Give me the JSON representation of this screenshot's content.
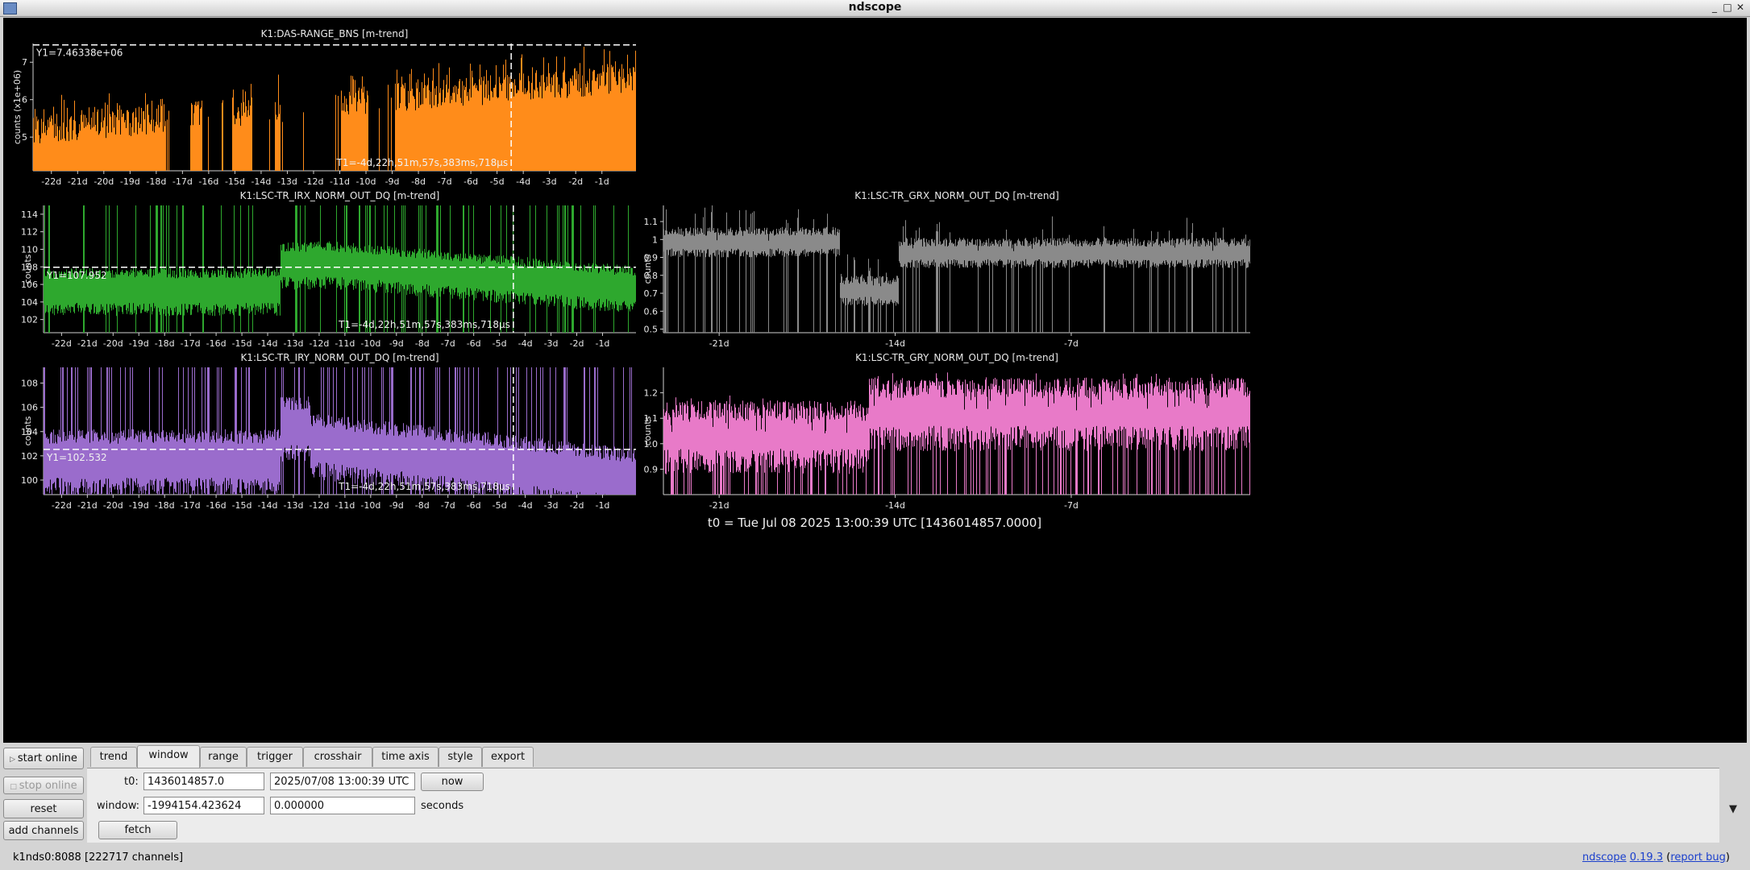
{
  "window": {
    "title": "ndscope"
  },
  "plots": [
    {
      "id": "bns",
      "title": "K1:DAS-RANGE_BNS [m-trend]",
      "ylabel": "counts (x1e+06)",
      "ylim": [
        4.1,
        7.5
      ],
      "yticks": [
        "5",
        "6",
        "7"
      ],
      "ytickvals": [
        5,
        6,
        7
      ],
      "xticks": [
        "-22d",
        "-21d",
        "-20d",
        "-19d",
        "-18d",
        "-17d",
        "-16d",
        "-15d",
        "-14d",
        "-13d",
        "-12d",
        "-11d",
        "-10d",
        "-9d",
        "-8d",
        "-7d",
        "-6d",
        "-5d",
        "-4d",
        "-3d",
        "-2d",
        "-1d"
      ],
      "color": "#ff8c1a",
      "y1": "Y1=7.46338e+06",
      "y1_value": 7.46338,
      "t1": "T1=-4d,22h,51m,57s,383ms,718µs"
    },
    {
      "id": "irx",
      "title": "K1:LSC-TR_IRX_NORM_OUT_DQ [m-trend]",
      "ylabel": "counts",
      "ylim": [
        100.5,
        115
      ],
      "yticks": [
        "102",
        "104",
        "106",
        "108",
        "110",
        "112",
        "114"
      ],
      "ytickvals": [
        102,
        104,
        106,
        108,
        110,
        112,
        114
      ],
      "xticks": [
        "-22d",
        "-21d",
        "-20d",
        "-19d",
        "-18d",
        "-17d",
        "-16d",
        "-15d",
        "-14d",
        "-13d",
        "-12d",
        "-11d",
        "-10d",
        "-9d",
        "-8d",
        "-7d",
        "-6d",
        "-5d",
        "-4d",
        "-3d",
        "-2d",
        "-1d"
      ],
      "color": "#2ea82e",
      "y1": "Y1=107.952",
      "y1_value": 107.952,
      "t1": "T1=-4d,22h,51m,57s,383ms,718µs"
    },
    {
      "id": "grx",
      "title": "K1:LSC-TR_GRX_NORM_OUT_DQ [m-trend]",
      "ylabel": "counts",
      "ylim": [
        0.48,
        1.19
      ],
      "yticks": [
        "0.5",
        "0.6",
        "0.7",
        "0.8",
        "0.9",
        "1",
        "1.1"
      ],
      "ytickvals": [
        0.5,
        0.6,
        0.7,
        0.8,
        0.9,
        1.0,
        1.1
      ],
      "xticks": [
        "-21d",
        "-14d",
        "-7d"
      ],
      "color": "#8a8a8a"
    },
    {
      "id": "iry",
      "title": "K1:LSC-TR_IRY_NORM_OUT_DQ [m-trend]",
      "ylabel": "counts",
      "ylim": [
        98.8,
        109.3
      ],
      "yticks": [
        "100",
        "102",
        "104",
        "106",
        "108"
      ],
      "ytickvals": [
        100,
        102,
        104,
        106,
        108
      ],
      "xticks": [
        "-22d",
        "-21d",
        "-20d",
        "-19d",
        "-18d",
        "-17d",
        "-16d",
        "-15d",
        "-14d",
        "-13d",
        "-12d",
        "-11d",
        "-10d",
        "-9d",
        "-8d",
        "-7d",
        "-6d",
        "-5d",
        "-4d",
        "-3d",
        "-2d",
        "-1d"
      ],
      "color": "#9a6ccc",
      "y1": "Y1=102.532",
      "y1_value": 102.532,
      "t1": "T1=-4d,22h,51m,57s,383ms,718µs"
    },
    {
      "id": "gry",
      "title": "K1:LSC-TR_GRY_NORM_OUT_DQ [m-trend]",
      "ylabel": "counts",
      "ylim": [
        0.8,
        1.3
      ],
      "yticks": [
        "0.9",
        "1.0",
        "1.1",
        "1.2"
      ],
      "ytickvals": [
        0.9,
        1.0,
        1.1,
        1.2
      ],
      "xticks": [
        "-21d",
        "-14d",
        "-7d"
      ],
      "color": "#e87ac8"
    }
  ],
  "t0_label": "t0 = Tue Jul 08 2025 13:00:39 UTC [1436014857.0000]",
  "left_buttons": {
    "start_online": "start online",
    "stop_online": "stop online",
    "reset": "reset",
    "add_channels": "add channels"
  },
  "tabs": [
    "trend",
    "window",
    "range",
    "trigger",
    "crosshair",
    "time axis",
    "style",
    "export"
  ],
  "active_tab": "window",
  "window_tab": {
    "t0_label": "t0:",
    "t0_gps": "1436014857.0",
    "t0_utc": "2025/07/08 13:00:39 UTC",
    "now_label": "now",
    "window_label": "window:",
    "window_start": "-1994154.423624",
    "window_end": "0.000000",
    "seconds_label": "seconds",
    "fetch_label": "fetch"
  },
  "status": {
    "server": "k1nds0:8088",
    "channels": "[222717 channels]",
    "app_link": "ndscope",
    "version_link": "0.19.3",
    "report_bug": "report bug"
  }
}
